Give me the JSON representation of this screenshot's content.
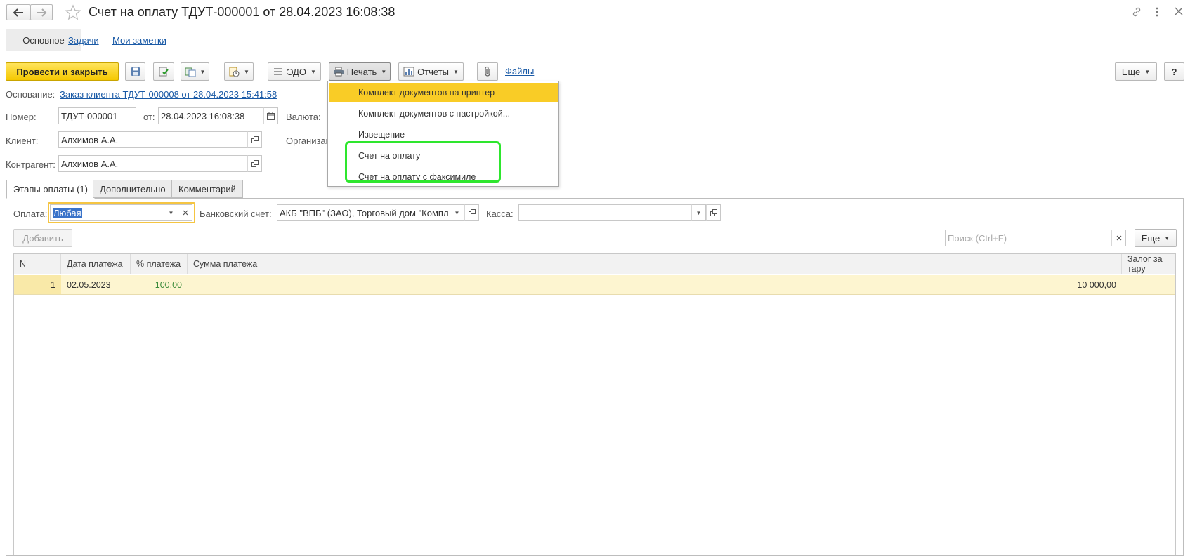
{
  "window": {
    "title": "Счет на оплату ТДУТ-000001 от 28.04.2023 16:08:38",
    "nav_tabs": [
      "Основное",
      "Задачи",
      "Мои заметки"
    ]
  },
  "toolbar": {
    "post_close": "Провести и закрыть",
    "edo": "ЭДО",
    "print": "Печать",
    "reports": "Отчеты",
    "files": "Файлы",
    "more": "Еще",
    "help": "?"
  },
  "print_menu": {
    "items": [
      "Комплект документов на принтер",
      "Комплект документов с настройкой...",
      "Извещение",
      "Счет на оплату",
      "Счет на оплату с факсимиле"
    ],
    "highlight_color": "#f9cc26",
    "outline_color": "#2ee62e"
  },
  "form": {
    "basis_label": "Основание:",
    "basis_value": "Заказ клиента ТДУТ-000008 от 28.04.2023 15:41:58",
    "number_label": "Номер:",
    "number_value": "ТДУТ-000001",
    "from_label": "от:",
    "date_value": "28.04.2023 16:08:38",
    "currency_label": "Валюта:",
    "client_label": "Клиент:",
    "client_value": "Алхимов А.А.",
    "org_label": "Организац",
    "counterparty_label": "Контрагент:",
    "counterparty_value": "Алхимов А.А."
  },
  "tabs": [
    "Этапы оплаты (1)",
    "Дополнительно",
    "Комментарий"
  ],
  "payment": {
    "payment_label": "Оплата:",
    "payment_value": "Любая",
    "bank_label": "Банковский счет:",
    "bank_value": "АКБ \"ВПБ\" (ЗАО), Торговый дом \"Компл",
    "cash_label": "Касса:",
    "cash_value": "",
    "add_button": "Добавить",
    "search_placeholder": "Поиск (Ctrl+F)",
    "more": "Еще"
  },
  "table": {
    "headers": [
      "N",
      "Дата платежа",
      "% платежа",
      "Сумма платежа",
      "Залог за тару"
    ],
    "rows": [
      {
        "n": "1",
        "date": "02.05.2023",
        "percent": "100,00",
        "sum": "10 000,00",
        "deposit": ""
      }
    ],
    "row_color": "#fdf5d0",
    "percent_color": "#3a8a3a"
  },
  "icons": [
    "back-arrow-icon",
    "forward-arrow-icon",
    "star-icon",
    "link-icon",
    "kebab-icon",
    "close-icon",
    "save-icon",
    "post-icon",
    "create-based-icon",
    "structure-icon",
    "edo-icon",
    "printer-icon",
    "reports-icon",
    "paperclip-icon",
    "calendar-icon",
    "open-icon",
    "dropdown-icon",
    "clear-icon"
  ]
}
